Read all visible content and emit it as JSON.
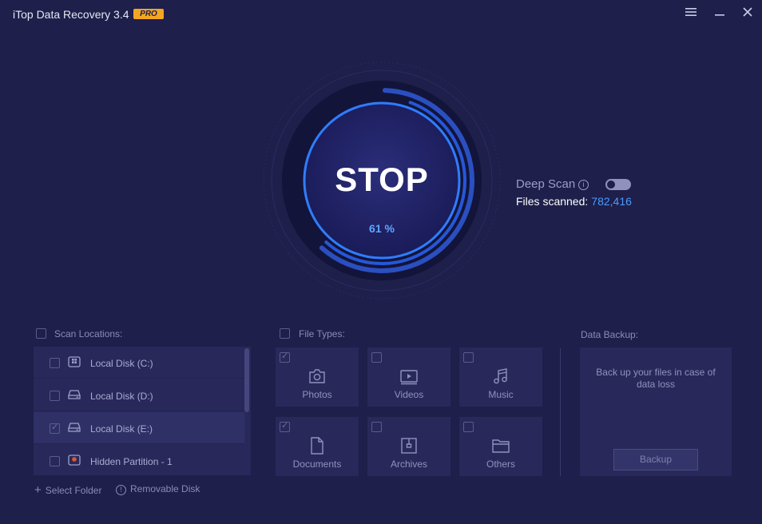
{
  "window": {
    "title": "iTop Data Recovery 3.4",
    "badge": "PRO",
    "menu_icon": "hamburger-menu-icon",
    "minimize_icon": "minimize-icon",
    "close_icon": "close-icon"
  },
  "scan": {
    "stop_label": "STOP",
    "progress_text": "61 %",
    "progress": 0.61,
    "deep_scan_label": "Deep Scan",
    "deep_scan_enabled": false,
    "files_scanned_label": "Files scanned:",
    "files_scanned_value": "782,416"
  },
  "scan_locations": {
    "label": "Scan Locations:",
    "items": [
      {
        "name": "Local Disk (C:)",
        "checked": false,
        "icon": "windows-drive-icon"
      },
      {
        "name": "Local Disk (D:)",
        "checked": false,
        "icon": "hard-drive-icon"
      },
      {
        "name": "Local Disk (E:)",
        "checked": true,
        "icon": "hard-drive-icon"
      },
      {
        "name": "Hidden Partition - 1",
        "checked": false,
        "icon": "hidden-partition-icon"
      }
    ],
    "select_folder": "Select Folder",
    "removable_disk": "Removable Disk"
  },
  "file_types": {
    "label": "File Types:",
    "items": [
      {
        "name": "Photos",
        "checked": true,
        "icon": "camera-icon"
      },
      {
        "name": "Videos",
        "checked": false,
        "icon": "video-icon"
      },
      {
        "name": "Music",
        "checked": false,
        "icon": "music-note-icon"
      },
      {
        "name": "Documents",
        "checked": true,
        "icon": "document-icon"
      },
      {
        "name": "Archives",
        "checked": false,
        "icon": "archive-box-icon"
      },
      {
        "name": "Others",
        "checked": false,
        "icon": "folder-icon"
      }
    ]
  },
  "data_backup": {
    "label": "Data Backup:",
    "description": "Back up your files in case of data loss",
    "button": "Backup"
  },
  "colors": {
    "background": "#1e1f4a",
    "accent": "#4a9bff",
    "panel": "#28295a",
    "badge": "#f3a623"
  }
}
